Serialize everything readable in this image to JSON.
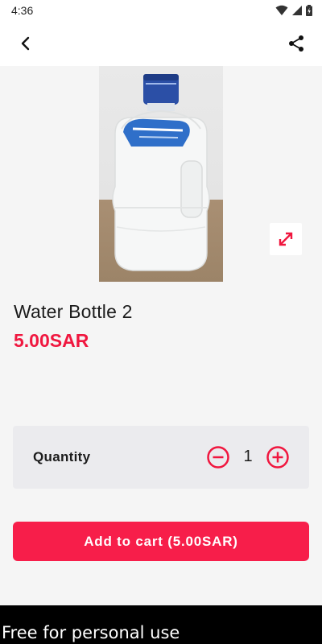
{
  "status_bar": {
    "time": "4:36"
  },
  "app_bar": {
    "back_icon": "chevron-left-icon",
    "share_icon": "share-icon"
  },
  "product": {
    "name": "Water Bottle 2",
    "price": "5.00SAR",
    "image": "water-bottle-photo"
  },
  "quantity": {
    "label": "Quantity",
    "value": "1",
    "minus_icon": "minus-circle-icon",
    "plus_icon": "plus-circle-icon"
  },
  "cart_button": {
    "label": "Add to cart (5.00SAR)"
  },
  "footer": {
    "text": "Free for personal use"
  },
  "colors": {
    "accent": "#f71e4a",
    "price": "#f0173f",
    "background": "#f5f5f5",
    "card": "#ebebee"
  }
}
